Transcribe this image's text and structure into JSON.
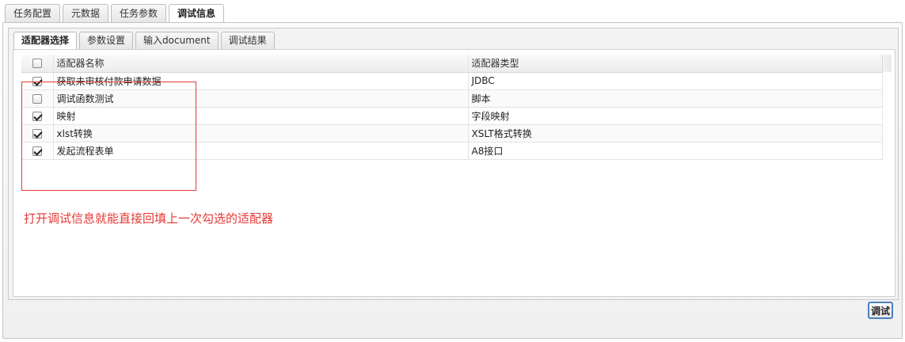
{
  "outer_tabs": [
    {
      "label": "任务配置",
      "active": false
    },
    {
      "label": "元数据",
      "active": false
    },
    {
      "label": "任务参数",
      "active": false
    },
    {
      "label": "调试信息",
      "active": true
    }
  ],
  "inner_tabs": [
    {
      "label": "适配器选择",
      "active": true
    },
    {
      "label": "参数设置",
      "active": false
    },
    {
      "label": "输入document",
      "active": false
    },
    {
      "label": "调试结果",
      "active": false
    }
  ],
  "table": {
    "columns": [
      "适配器名称",
      "适配器类型"
    ],
    "header_checked": false,
    "rows": [
      {
        "checked": true,
        "name": "获取未审核付款申请数据",
        "type": "JDBC"
      },
      {
        "checked": false,
        "name": "调试函数测试",
        "type": "脚本"
      },
      {
        "checked": true,
        "name": "映射",
        "type": "字段映射"
      },
      {
        "checked": true,
        "name": "xlst转换",
        "type": "XSLT格式转换"
      },
      {
        "checked": true,
        "name": "发起流程表单",
        "type": "A8接口"
      }
    ]
  },
  "annotation": {
    "text": "打开调试信息就能直接回填上一次勾选的适配器",
    "color": "#e53935"
  },
  "footer": {
    "debug_label": "调试"
  }
}
